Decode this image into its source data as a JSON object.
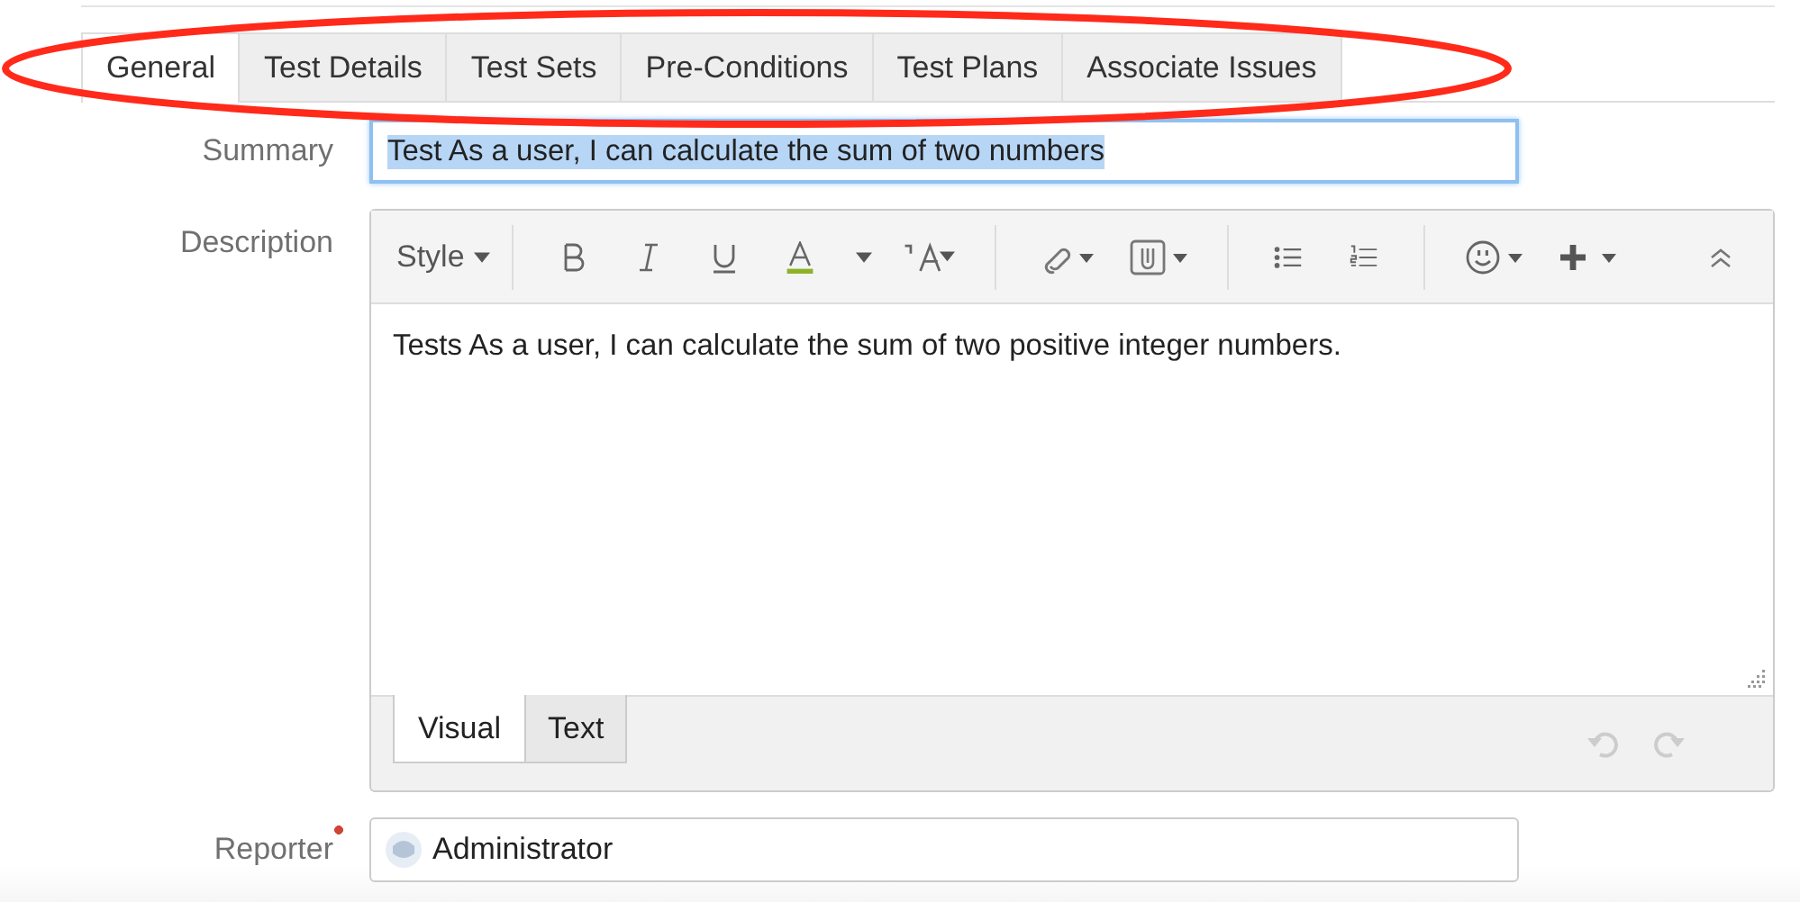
{
  "tabs": [
    {
      "label": "General",
      "selected": true
    },
    {
      "label": "Test Details",
      "selected": false
    },
    {
      "label": "Test Sets",
      "selected": false
    },
    {
      "label": "Pre-Conditions",
      "selected": false
    },
    {
      "label": "Test Plans",
      "selected": false
    },
    {
      "label": "Associate Issues",
      "selected": false
    }
  ],
  "summary": {
    "label": "Summary",
    "value": "Test As a user, I can calculate the sum of two numbers",
    "text_selected": true
  },
  "description": {
    "label": "Description",
    "toolbar": {
      "style_label": "Style"
    },
    "content": "Tests As a user, I can calculate the sum of two positive integer numbers.",
    "editor_tabs": [
      {
        "label": "Visual",
        "selected": true
      },
      {
        "label": "Text",
        "selected": false
      }
    ]
  },
  "reporter": {
    "label": "Reporter",
    "required": true,
    "value": "Administrator"
  },
  "annotation": {
    "kind": "ellipse",
    "color": "#ff2a1a"
  }
}
